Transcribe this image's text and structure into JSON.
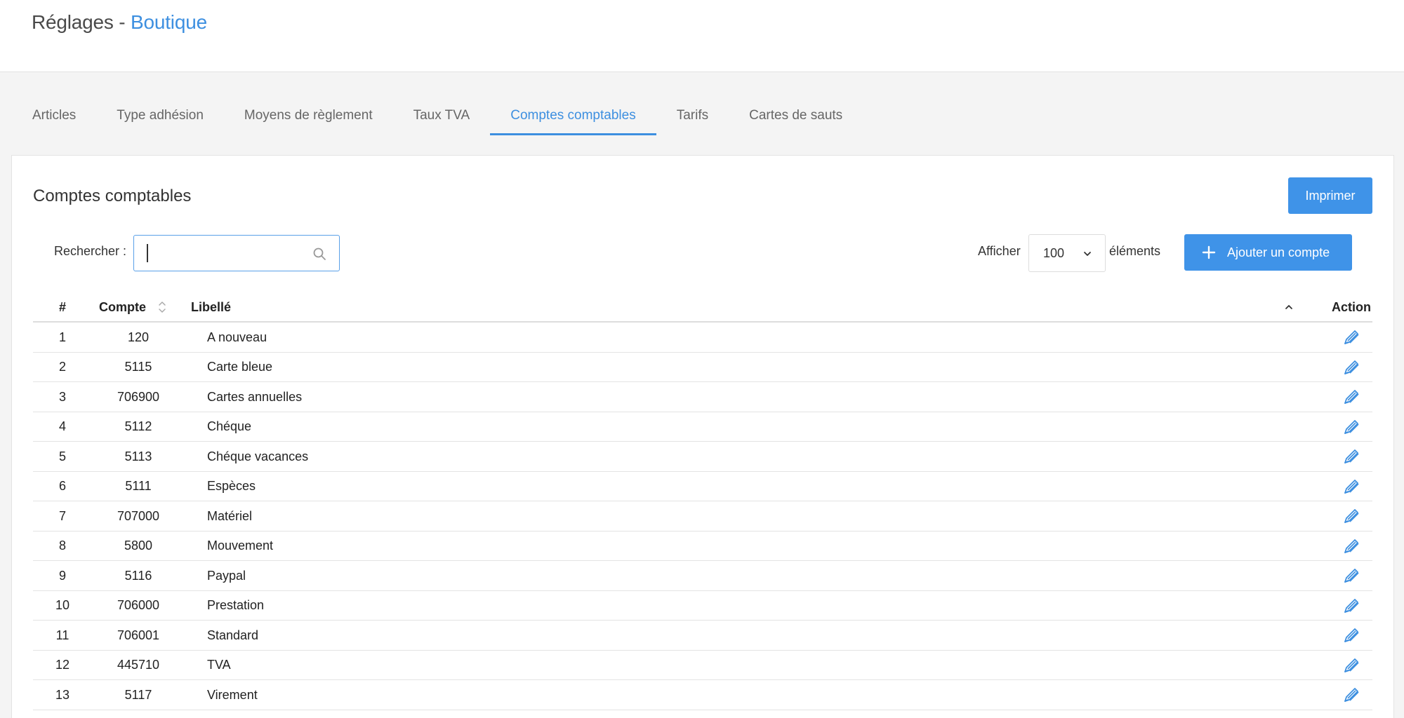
{
  "header": {
    "title_prefix": "Réglages - ",
    "title_accent": "Boutique"
  },
  "tabs": [
    {
      "label": "Articles",
      "active": false
    },
    {
      "label": "Type adhésion",
      "active": false
    },
    {
      "label": "Moyens de règlement",
      "active": false
    },
    {
      "label": "Taux TVA",
      "active": false
    },
    {
      "label": "Comptes comptables",
      "active": true
    },
    {
      "label": "Tarifs",
      "active": false
    },
    {
      "label": "Cartes de sauts",
      "active": false
    }
  ],
  "card": {
    "title": "Comptes comptables",
    "print_label": "Imprimer",
    "search_label": "Rechercher :",
    "search_value": "",
    "show_label": "Afficher",
    "page_size": "100",
    "elements_label": "éléments",
    "add_label": "Ajouter un compte"
  },
  "table": {
    "headers": {
      "num": "#",
      "compte": "Compte",
      "libelle": "Libellé",
      "action": "Action"
    },
    "rows": [
      {
        "num": "1",
        "compte": "120",
        "libelle": "A nouveau"
      },
      {
        "num": "2",
        "compte": "5115",
        "libelle": "Carte bleue"
      },
      {
        "num": "3",
        "compte": "706900",
        "libelle": "Cartes annuelles"
      },
      {
        "num": "4",
        "compte": "5112",
        "libelle": "Chéque"
      },
      {
        "num": "5",
        "compte": "5113",
        "libelle": "Chéque vacances"
      },
      {
        "num": "6",
        "compte": "5111",
        "libelle": "Espèces"
      },
      {
        "num": "7",
        "compte": "707000",
        "libelle": "Matériel"
      },
      {
        "num": "8",
        "compte": "5800",
        "libelle": "Mouvement"
      },
      {
        "num": "9",
        "compte": "5116",
        "libelle": "Paypal"
      },
      {
        "num": "10",
        "compte": "706000",
        "libelle": "Prestation"
      },
      {
        "num": "11",
        "compte": "706001",
        "libelle": "Standard"
      },
      {
        "num": "12",
        "compte": "445710",
        "libelle": "TVA"
      },
      {
        "num": "13",
        "compte": "5117",
        "libelle": "Virement"
      }
    ]
  },
  "icons": {
    "search": "search-icon",
    "chevron": "chevron-down-icon",
    "plus": "plus-icon",
    "sort": "sort-icon",
    "sort_up": "chevron-up-icon",
    "edit": "pencil-icon"
  },
  "colors": {
    "accent": "#3d8fe0",
    "button": "#3f93e8"
  }
}
